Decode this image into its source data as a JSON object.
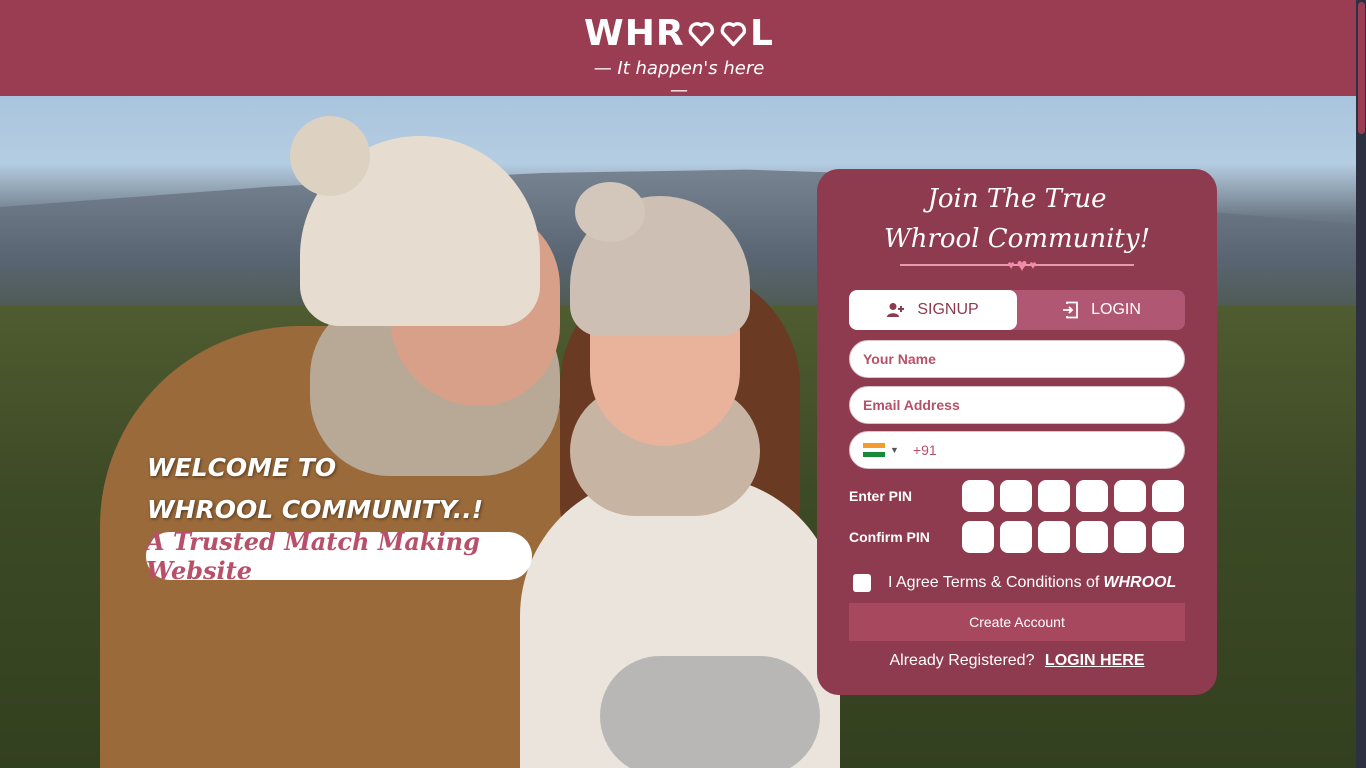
{
  "header": {
    "logo_text": "WHR",
    "logo_text_end": "L",
    "tagline": "— It happen's here —"
  },
  "hero": {
    "welcome_line1": "WELCOME TO",
    "welcome_line2": "WHROOL COMMUNITY..!",
    "pill_text": "A Trusted Match Making Website"
  },
  "form": {
    "title_line1": "Join The True",
    "title_line2": "Whrool Community!",
    "tabs": [
      {
        "label": "SIGNUP",
        "icon": "user-plus-icon",
        "active": true
      },
      {
        "label": "LOGIN",
        "icon": "login-icon",
        "active": false
      }
    ],
    "name_placeholder": "Your Name",
    "email_placeholder": "Email Address",
    "phone_code": "+91",
    "phone_flag": "india-flag",
    "enter_pin_label": "Enter PIN",
    "confirm_pin_label": "Confirm PIN",
    "agree_text": "I Agree Terms & Conditions of",
    "agree_brand": "WHROOL",
    "create_button": "Create Account",
    "already_text": "Already Registered?",
    "login_link": "LOGIN HERE"
  },
  "colors": {
    "brand": "#9a3d52",
    "card": "#8e3a4f",
    "accent_pink": "#b8506a"
  }
}
